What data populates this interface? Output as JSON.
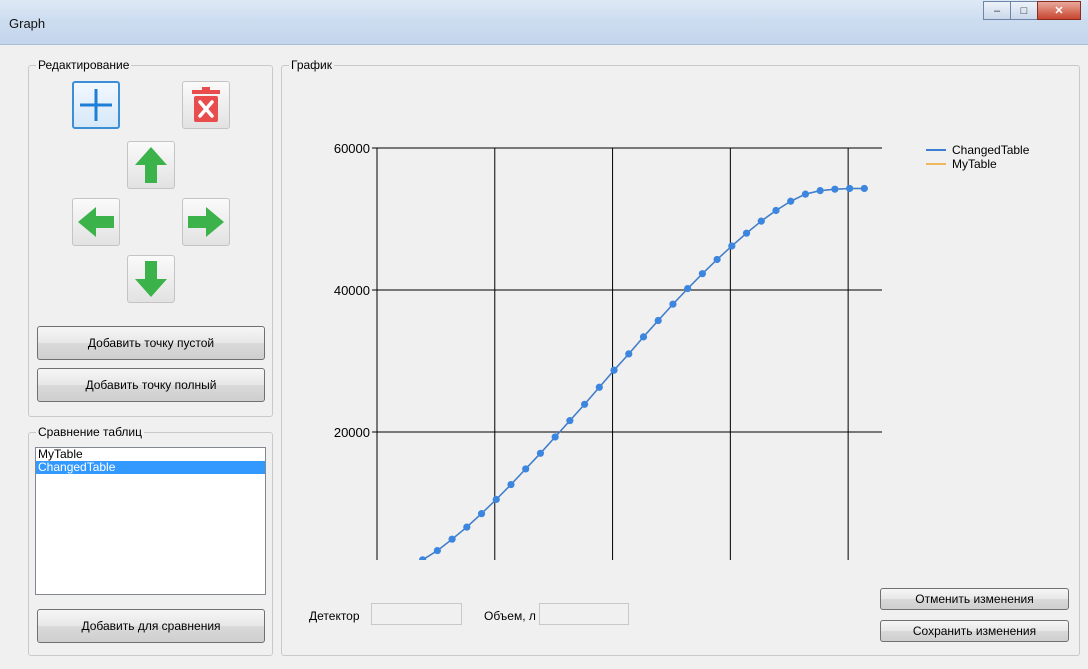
{
  "window": {
    "title": "Graph",
    "minimize_glyph": "–",
    "maximize_glyph": "□",
    "close_glyph": "✕"
  },
  "edit_group": {
    "label": "Редактирование",
    "icons": [
      "plus-icon",
      "delete-icon",
      "arrow-up-icon",
      "arrow-left-icon",
      "arrow-right-icon",
      "arrow-down-icon"
    ],
    "add_empty_label": "Добавить точку пустой",
    "add_full_label": "Добавить точку полный"
  },
  "compare_group": {
    "label": "Сравнение таблиц",
    "items": [
      {
        "label": "MyTable",
        "selected": false
      },
      {
        "label": "ChangedTable",
        "selected": true
      }
    ],
    "add_compare_label": "Добавить для сравнения"
  },
  "graph_group": {
    "label": "График",
    "detector_label": "Детектор",
    "detector_value": "",
    "volume_label": "Объем, л",
    "volume_value": "",
    "cancel_label": "Отменить изменения",
    "save_label": "Сохранить изменения"
  },
  "colors": {
    "changed_table": "#3a7fd5",
    "my_table": "#f0b85c",
    "points": "#3d86e0",
    "accent": "#3399ff"
  },
  "chart_data": {
    "type": "line",
    "title": "",
    "xlabel": "",
    "ylabel": "",
    "xlim": [
      7725,
      16300
    ],
    "ylim": [
      0,
      60000
    ],
    "xticks": [
      7725,
      9725,
      11725,
      13725,
      15725
    ],
    "yticks": [
      0,
      20000,
      40000,
      60000
    ],
    "grid": true,
    "legend_position": "top-right",
    "series": [
      {
        "name": "ChangedTable",
        "x": [
          8000,
          8250,
          8500,
          8750,
          9000,
          9250,
          9500,
          9750,
          10000,
          10250,
          10500,
          10750,
          11000,
          11250,
          11500,
          11750,
          12000,
          12250,
          12500,
          12750,
          13000,
          13250,
          13500,
          13750,
          14000,
          14250,
          14500,
          14750,
          15000,
          15250,
          15500,
          15750,
          16000
        ],
        "y": [
          200,
          900,
          2000,
          3300,
          4900,
          6600,
          8500,
          10500,
          12600,
          14800,
          17000,
          19300,
          21600,
          23900,
          26300,
          28700,
          31000,
          33400,
          35700,
          38000,
          40200,
          42300,
          44300,
          46200,
          48000,
          49700,
          51200,
          52500,
          53500,
          54000,
          54200,
          54300,
          54300
        ]
      },
      {
        "name": "MyTable",
        "x": [
          8000,
          8250,
          8500,
          8750,
          9000,
          9250,
          9500,
          9750,
          10000,
          10250,
          10500,
          10750,
          11000,
          11250,
          11500,
          11750,
          12000,
          12250,
          12500,
          12750,
          13000,
          13250,
          13500,
          13750,
          14000,
          14250,
          14500,
          14750,
          15000,
          15250,
          15500,
          15750,
          16000
        ],
        "y": [
          200,
          900,
          2000,
          3300,
          4900,
          6600,
          8500,
          10500,
          12600,
          14800,
          17000,
          19300,
          21600,
          23900,
          26300,
          28700,
          31000,
          33400,
          35700,
          38000,
          40200,
          42300,
          44300,
          46200,
          48000,
          49700,
          51200,
          52500,
          53500,
          54000,
          54200,
          54300,
          54300
        ]
      }
    ]
  }
}
